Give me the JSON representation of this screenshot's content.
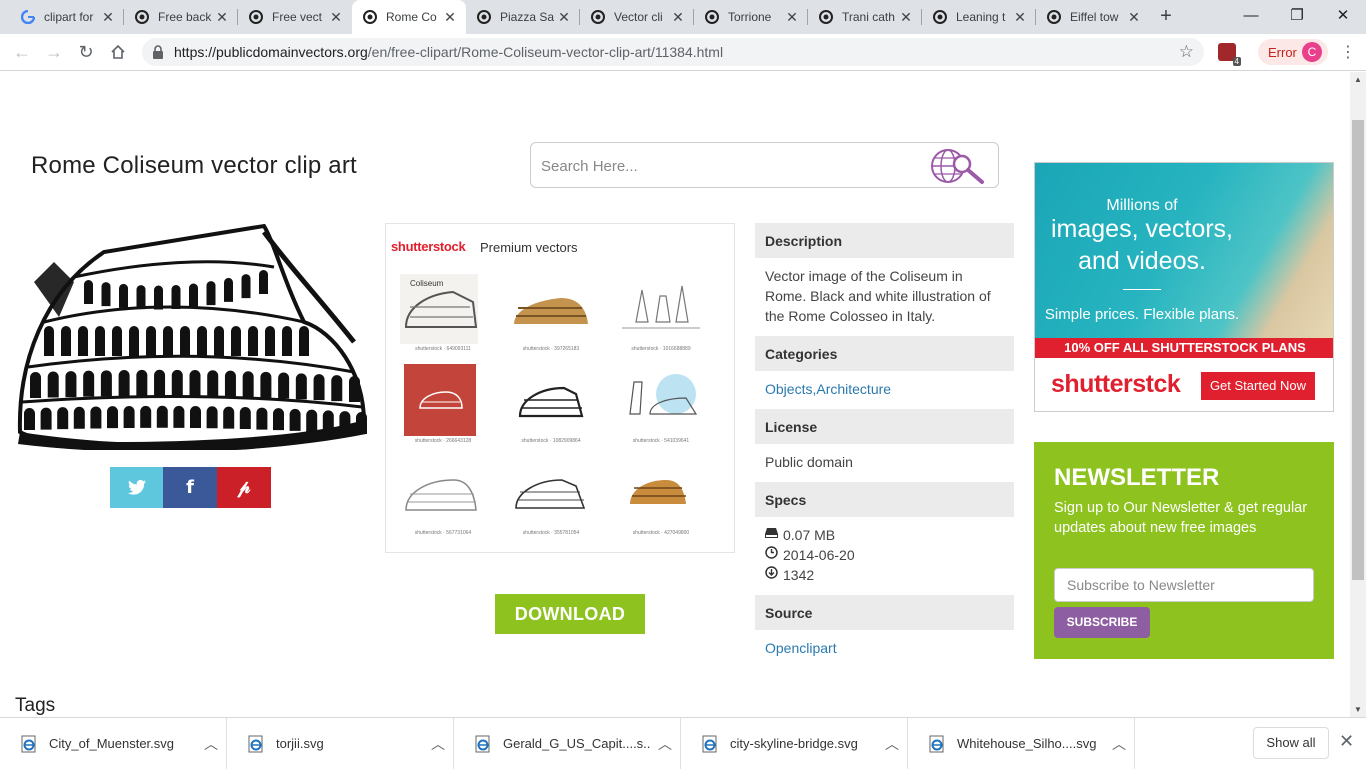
{
  "browser": {
    "tabs": [
      {
        "title": "clipart for",
        "favicon": "google-icon",
        "active": false
      },
      {
        "title": "Free back",
        "favicon": "pdv-icon",
        "active": false
      },
      {
        "title": "Free vect",
        "favicon": "pdv-icon",
        "active": false
      },
      {
        "title": "Rome Co",
        "favicon": "pdv-icon",
        "active": true
      },
      {
        "title": "Piazza Sa",
        "favicon": "pdv-icon",
        "active": false
      },
      {
        "title": "Vector cli",
        "favicon": "pdv-icon",
        "active": false
      },
      {
        "title": "Torrione",
        "favicon": "pdv-icon",
        "active": false
      },
      {
        "title": "Trani cath",
        "favicon": "pdv-icon",
        "active": false
      },
      {
        "title": "Leaning t",
        "favicon": "pdv-icon",
        "active": false
      },
      {
        "title": "Eiffel tow",
        "favicon": "pdv-icon",
        "active": false
      }
    ],
    "url_host": "https://publicdomainvectors.org",
    "url_path": "/en/free-clipart/Rome-Coliseum-vector-clip-art/11384.html",
    "extension_badge": "4",
    "profile_status": "Error",
    "profile_initial": "C"
  },
  "page": {
    "title": "Rome Coliseum vector clip art",
    "search_placeholder": "Search Here...",
    "share": [
      {
        "icon": "twitter-icon",
        "glyph": "t",
        "color": "#5ec7de"
      },
      {
        "icon": "facebook-icon",
        "glyph": "f",
        "color": "#3b5998"
      },
      {
        "icon": "pinterest-icon",
        "glyph": "p",
        "color": "#cb2027"
      }
    ],
    "shutterstock": {
      "logo": "shutterstock",
      "label": "Premium vectors",
      "captions": [
        "shutterstock · 649093111",
        "shutterstock · 397265183",
        "shutterstock · 1016688889",
        "shutterstock · 266643128",
        "shutterstock · 1082909864",
        "shutterstock · 541039641",
        "shutterstock · 567731064",
        "shutterstock · 355781054",
        "shutterstock · 427049800"
      ]
    },
    "download_label": "DOWNLOAD",
    "info": {
      "description_head": "Description",
      "description": "Vector image of the Coliseum in Rome. Black and white illustration of the Rome Colosseo in Italy.",
      "categories_head": "Categories",
      "category_1": "Objects",
      "category_sep": ",",
      "category_2": "Architecture",
      "license_head": "License",
      "license": "Public domain",
      "specs_head": "Specs",
      "size": "0.07 MB",
      "date": "2014-06-20",
      "downloads": "1342",
      "source_head": "Source",
      "source": "Openclipart"
    },
    "ad": {
      "line1": "Millions of",
      "line2": "images, vectors,",
      "line3": "and videos.",
      "line4": "Simple prices. Flexible plans.",
      "promo": "10% OFF ALL SHUTTERSTOCK PLANS",
      "logo": "shutterstck",
      "cta": "Get Started Now"
    },
    "newsletter": {
      "title": "NEWSLETTER",
      "text": "Sign up to Our Newsletter & get regular updates about new free images",
      "placeholder": "Subscribe to Newsletter",
      "button": "SUBSCRIBE"
    },
    "tags_heading": "Tags"
  },
  "downloads_shelf": {
    "files": [
      "City_of_Muenster.svg",
      "torjii.svg",
      "Gerald_G_US_Capit....s...",
      "city-skyline-bridge.svg",
      "Whitehouse_Silho....svg"
    ],
    "show_all": "Show all"
  },
  "colors": {
    "accent_green": "#8dc21f",
    "shutterstock_red": "#e0202e",
    "link_blue": "#2a7ab0",
    "subscribe_purple": "#8e5ea2"
  }
}
